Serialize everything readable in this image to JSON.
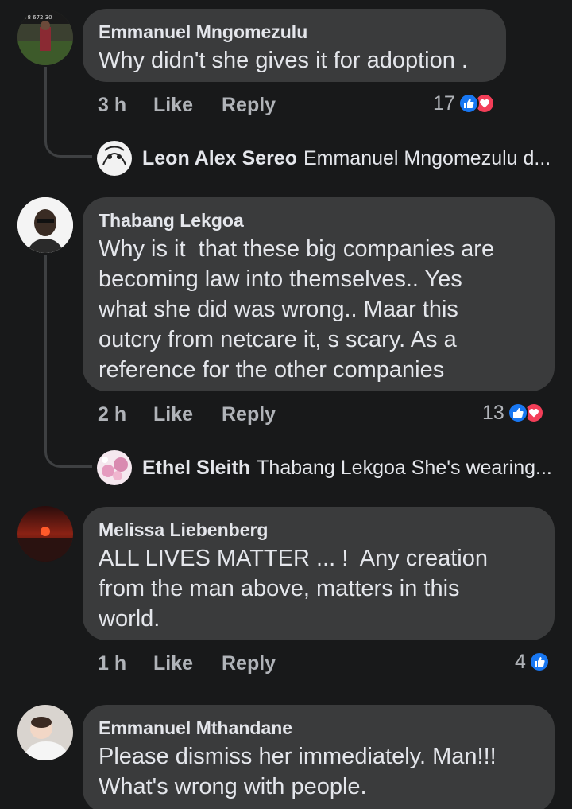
{
  "comments": [
    {
      "author": "Emmanuel Mngomezulu",
      "text": "Why didn't she gives it for adoption .",
      "time": "3 h",
      "like_label": "Like",
      "reply_label": "Reply",
      "reaction_count": "17",
      "reactions": [
        "like-icon",
        "love-icon"
      ],
      "reply_preview": {
        "author": "Leon Alex Sereo",
        "text": "Emmanuel Mngomezulu d..."
      }
    },
    {
      "author": "Thabang Lekgoa",
      "text": "Why is it  that these big companies are\nbecoming law into themselves.. Yes\nwhat she did was wrong.. Maar this\noutcry from netcare it, s scary. As a\nreference for the other companies",
      "time": "2 h",
      "like_label": "Like",
      "reply_label": "Reply",
      "reaction_count": "13",
      "reactions": [
        "like-icon",
        "love-icon"
      ],
      "reply_preview": {
        "author": "Ethel Sleith",
        "text": "Thabang Lekgoa She's wearing..."
      }
    },
    {
      "author": "Melissa Liebenberg",
      "text": "ALL LIVES MATTER ... !  Any creation\nfrom the man above, matters in this\nworld.",
      "time": "1 h",
      "like_label": "Like",
      "reply_label": "Reply",
      "reaction_count": "4",
      "reactions": [
        "like-icon"
      ]
    },
    {
      "author": "Emmanuel Mthandane",
      "text": "Please dismiss her immediately. Man!!!\nWhat's wrong with people."
    }
  ],
  "colors": {
    "background": "#18191a",
    "bubble": "#3a3b3c",
    "primary_text": "#e4e6eb",
    "secondary_text": "#b0b3b8",
    "like_blue": "#1877f2",
    "love_red": "#f33e58"
  }
}
